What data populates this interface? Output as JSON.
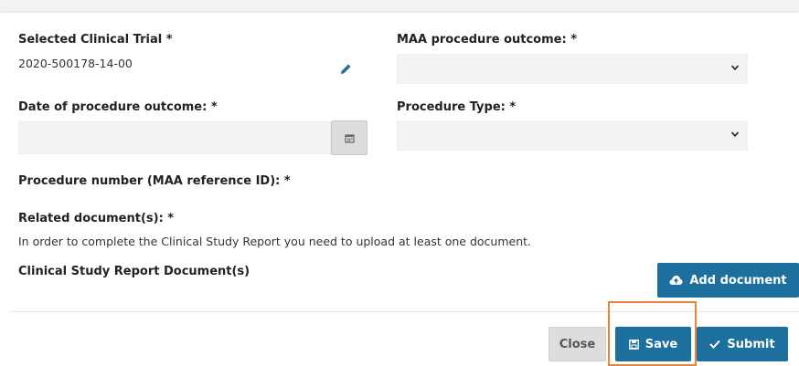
{
  "form": {
    "selected_trial_label": "Selected Clinical Trial *",
    "selected_trial_value": "2020-500178-14-00",
    "maa_outcome_label": "MAA procedure outcome: *",
    "maa_outcome_value": "",
    "date_outcome_label": "Date of procedure outcome: *",
    "date_outcome_value": "",
    "procedure_type_label": "Procedure Type: *",
    "procedure_type_value": "",
    "procedure_number_label": "Procedure number (MAA reference ID): *",
    "related_docs_label": "Related document(s): *",
    "related_docs_help": "In order to complete the Clinical Study Report you need to upload at least one document.",
    "csr_docs_label": "Clinical Study Report Document(s)",
    "add_document_label": "Add document"
  },
  "footer": {
    "close_label": "Close",
    "save_label": "Save",
    "submit_label": "Submit"
  },
  "icons": {
    "edit": "pencil-icon",
    "calendar": "calendar-icon",
    "chevron": "chevron-down-icon",
    "upload": "cloud-upload-icon",
    "save": "floppy-disk-icon",
    "submit": "checkmark-icon"
  },
  "colors": {
    "primary": "#1d6f9e",
    "highlight": "#e8833a",
    "input_bg": "#f2f3f5"
  }
}
